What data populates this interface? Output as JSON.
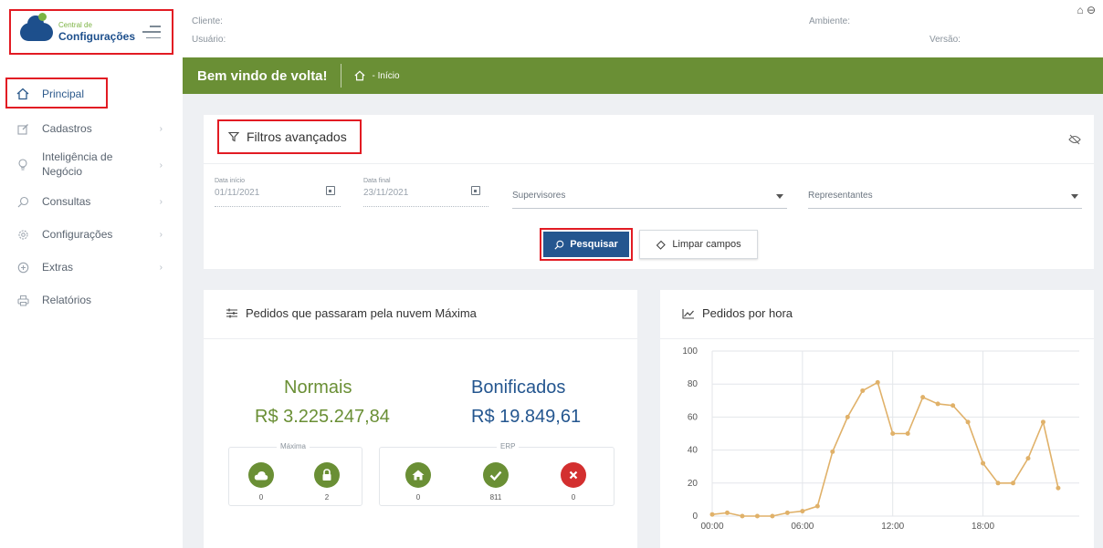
{
  "logo": {
    "small": "Central de",
    "big": "Configurações"
  },
  "sidebar": {
    "items": [
      {
        "label": "Principal",
        "icon": "home-icon"
      },
      {
        "label": "Cadastros",
        "icon": "edit-icon"
      },
      {
        "label": "Inteligência de Negócio",
        "icon": "lightbulb-icon"
      },
      {
        "label": "Consultas",
        "icon": "search-icon"
      },
      {
        "label": "Configurações",
        "icon": "gear-icon"
      },
      {
        "label": "Extras",
        "icon": "plus-circle-icon"
      },
      {
        "label": "Relatórios",
        "icon": "printer-icon"
      }
    ]
  },
  "header": {
    "cliente": "Cliente:",
    "usuario": "Usuário:",
    "ambiente": "Ambiente:",
    "versao": "Versão:"
  },
  "greenbar": {
    "welcome": "Bem vindo de volta!",
    "crumb": "- Início"
  },
  "filters": {
    "title": "Filtros avançados",
    "data_inicio_label": "Data início",
    "data_inicio_value": "01/11/2021",
    "data_final_label": "Data final",
    "data_final_value": "23/11/2021",
    "supervisores": "Supervisores",
    "representantes": "Representantes",
    "search_label": "Pesquisar",
    "clear_label": "Limpar campos"
  },
  "orders": {
    "title": "Pedidos que passaram pela nuvem Máxima",
    "normais_label": "Normais",
    "normais_value": "R$ 3.225.247,84",
    "bonificados_label": "Bonificados",
    "bonificados_value": "R$ 19.849,61",
    "maxima_label": "Máxima",
    "erp_label": "ERP",
    "counts": {
      "cloud": "0",
      "lock": "2",
      "home": "0",
      "check": "811",
      "error": "0"
    }
  },
  "colors": {
    "green": "#6a8f35",
    "blue": "#24568f",
    "highlight": "#e21b23",
    "line": "#e0b169",
    "error": "#d32f2f"
  },
  "chart_data": {
    "type": "line",
    "title": "Pedidos por hora",
    "ylim": [
      0,
      100
    ],
    "yticks": [
      "0",
      "20",
      "40",
      "60",
      "80",
      "100"
    ],
    "xticks": [
      "00:00",
      "06:00",
      "12:00",
      "18:00"
    ],
    "x": [
      0,
      1,
      2,
      3,
      4,
      5,
      6,
      7,
      8,
      9,
      10,
      11,
      12,
      13,
      14,
      15,
      16,
      17,
      18,
      19,
      20,
      21,
      22,
      23
    ],
    "series": [
      {
        "values": [
          1,
          2,
          0,
          0,
          0,
          2,
          3,
          6,
          39,
          60,
          76,
          81,
          50,
          50,
          72,
          68,
          67,
          57,
          32,
          20,
          20,
          35,
          57,
          17
        ]
      }
    ]
  }
}
